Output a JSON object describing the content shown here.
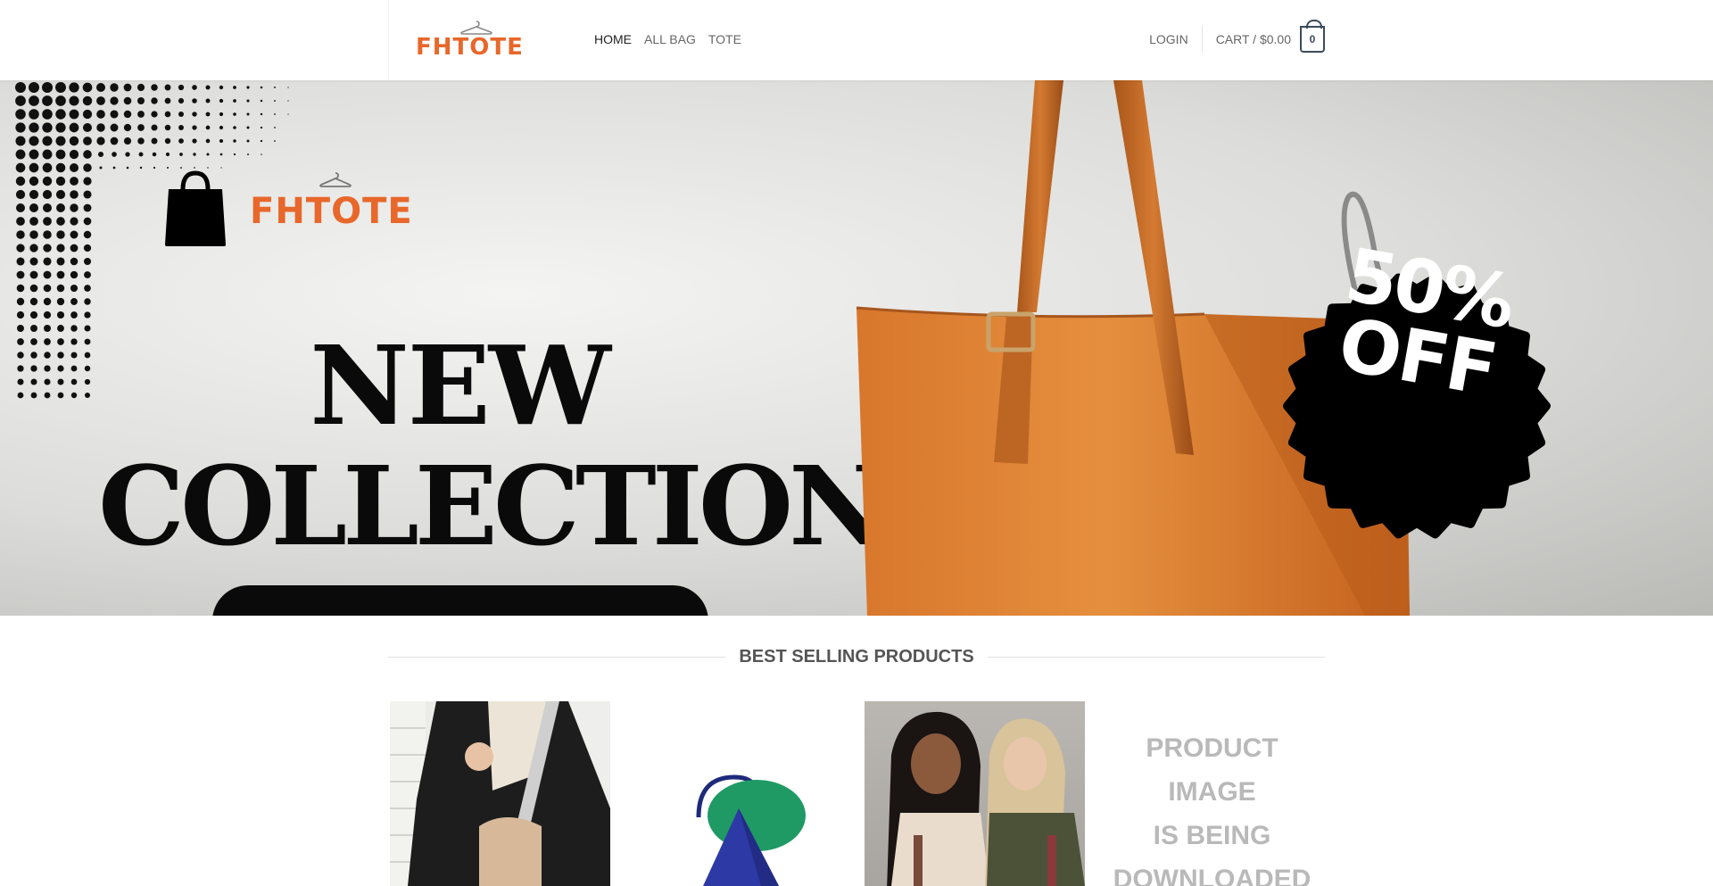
{
  "header": {
    "logo_text": "FHTOTE",
    "nav": [
      {
        "label": "HOME",
        "active": true
      },
      {
        "label": "ALL BAG",
        "active": false
      },
      {
        "label": "TOTE",
        "active": false
      }
    ],
    "login_label": "LOGIN",
    "cart_label": "CART / $0.00",
    "cart_count": "0"
  },
  "hero": {
    "logo_text": "FHTOTE",
    "headline_line1": "NEW",
    "headline_line2": "COLLECTION",
    "badge_line1": "50%",
    "badge_line2": "OFF"
  },
  "best_selling": {
    "title": "BEST SELLING PRODUCTS",
    "products": [
      {
        "image": "woman-blazer-crossbody-bag"
      },
      {
        "image": "blue-green-bag"
      },
      {
        "image": "two-women-bags"
      },
      {
        "placeholder_lines": [
          "PRODUCT",
          "IMAGE",
          "IS BEING",
          "DOWNLOADED"
        ]
      }
    ]
  },
  "colors": {
    "brand_orange": "#e8672a",
    "text_dark": "#222222",
    "nav_gray": "#666666",
    "badge_black": "#0a0a0a"
  }
}
